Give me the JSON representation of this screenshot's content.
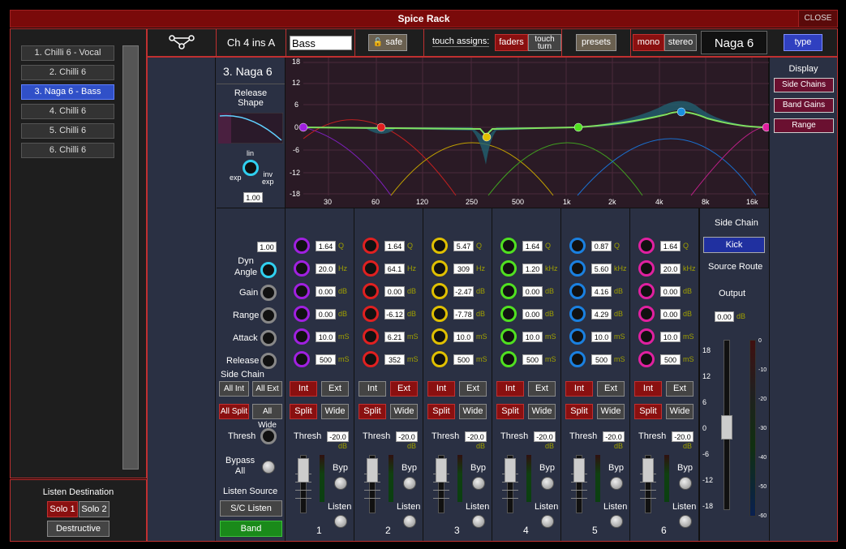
{
  "window": {
    "title": "Spice Rack",
    "close_label": "CLOSE"
  },
  "sidebar": {
    "items": [
      {
        "label": "1. Chilli 6 - Vocal"
      },
      {
        "label": "2. Chilli 6"
      },
      {
        "label": "3. Naga 6 - Bass"
      },
      {
        "label": "4. Chilli 6"
      },
      {
        "label": "5. Chilli 6"
      },
      {
        "label": "6. Chilli 6"
      }
    ],
    "selected_index": 2
  },
  "listen_dest": {
    "title": "Listen Destination",
    "solo1": "Solo 1",
    "solo2": "Solo 2",
    "destructive": "Destructive"
  },
  "topbar": {
    "channel": "Ch 4 ins A",
    "name_value": "Bass",
    "safe": "safe",
    "touch_assigns": "touch assigns:",
    "faders": "faders",
    "touch_turn_1": "touch",
    "touch_turn_2": "turn",
    "presets": "presets",
    "mono": "mono",
    "stereo": "stereo",
    "plugin": "Naga 6",
    "type": "type"
  },
  "left_panel": {
    "plugin_title": "3. Naga 6",
    "release_shape_1": "Release",
    "release_shape_2": "Shape",
    "lin": "lin",
    "exp": "exp",
    "inv": "inv",
    "exp2": "exp",
    "release_value": "1.00",
    "dyn_angle_value": "1.00",
    "dyn_label_1": "Dyn",
    "dyn_label_2": "Angle",
    "gain": "Gain",
    "range": "Range",
    "attack": "Attack",
    "release": "Release",
    "side_chain": "Side Chain",
    "all_int": "All Int",
    "all_ext": "All Ext",
    "all_split": "All Split",
    "all_wide": "All Wide",
    "thresh": "Thresh",
    "bypass_1": "Bypass",
    "bypass_2": "All",
    "listen_source": "Listen Source",
    "sc_listen": "S/C Listen",
    "band": "Band"
  },
  "eq": {
    "y_ticks": [
      "18",
      "12",
      "6",
      "0",
      "-6",
      "-12",
      "-18"
    ],
    "x_ticks": [
      "30",
      "60",
      "120",
      "250",
      "500",
      "1k",
      "2k",
      "4k",
      "8k",
      "16k"
    ]
  },
  "bands": [
    {
      "num": "1",
      "color": "#a020e0",
      "q": "1.64",
      "freq": "20.0",
      "freq_unit": "Hz",
      "gain": "0.00",
      "range": "0.00",
      "attack": "10.0",
      "release": "500",
      "thresh": "-20.0",
      "int": "Int",
      "ext": "Ext",
      "split": "Split",
      "wide": "Wide",
      "int_active": true,
      "ext_active": false
    },
    {
      "num": "2",
      "color": "#e02020",
      "q": "1.64",
      "freq": "64.1",
      "freq_unit": "Hz",
      "gain": "0.00",
      "range": "-6.12",
      "attack": "6.21",
      "release": "352",
      "thresh": "-20.0",
      "int": "Int",
      "ext": "Ext",
      "split": "Split",
      "wide": "Wide",
      "int_active": false,
      "ext_active": true
    },
    {
      "num": "3",
      "color": "#e0c000",
      "q": "5.47",
      "freq": "309",
      "freq_unit": "Hz",
      "gain": "-2.47",
      "range": "-7.78",
      "attack": "10.0",
      "release": "500",
      "thresh": "-20.0",
      "int": "Int",
      "ext": "Ext",
      "split": "Split",
      "wide": "Wide",
      "int_active": true,
      "ext_active": false
    },
    {
      "num": "4",
      "color": "#50e020",
      "q": "1.64",
      "freq": "1.20",
      "freq_unit": "kHz",
      "gain": "0.00",
      "range": "0.00",
      "attack": "10.0",
      "release": "500",
      "thresh": "-20.0",
      "int": "Int",
      "ext": "Ext",
      "split": "Split",
      "wide": "Wide",
      "int_active": true,
      "ext_active": false
    },
    {
      "num": "5",
      "color": "#1a80e0",
      "q": "0.87",
      "freq": "5.60",
      "freq_unit": "kHz",
      "gain": "4.16",
      "range": "4.29",
      "attack": "10.0",
      "release": "500",
      "thresh": "-20.0",
      "int": "Int",
      "ext": "Ext",
      "split": "Split",
      "wide": "Wide",
      "int_active": true,
      "ext_active": false
    },
    {
      "num": "6",
      "color": "#e020a0",
      "q": "1.64",
      "freq": "20.0",
      "freq_unit": "kHz",
      "gain": "0.00",
      "range": "0.00",
      "attack": "10.0",
      "release": "500",
      "thresh": "-20.0",
      "int": "Int",
      "ext": "Ext",
      "split": "Split",
      "wide": "Wide",
      "int_active": true,
      "ext_active": false
    }
  ],
  "units": {
    "q": "Q",
    "db": "dB",
    "ms": "mS",
    "thresh": "Thresh",
    "byp": "Byp",
    "listen": "Listen"
  },
  "right_panel": {
    "side_chain": "Side Chain",
    "kick": "Kick",
    "source_route": "Source Route",
    "output": "Output",
    "output_value": "0.00",
    "fader_ticks": [
      "18",
      "12",
      "6",
      "0",
      "-6",
      "-12",
      "-18"
    ],
    "meter_ticks": [
      "0",
      "-10",
      "-20",
      "-30",
      "-40",
      "-50",
      "-60"
    ]
  },
  "display": {
    "title": "Display",
    "side_chains": "Side Chains",
    "band_gains": "Band Gains",
    "range": "Range"
  }
}
